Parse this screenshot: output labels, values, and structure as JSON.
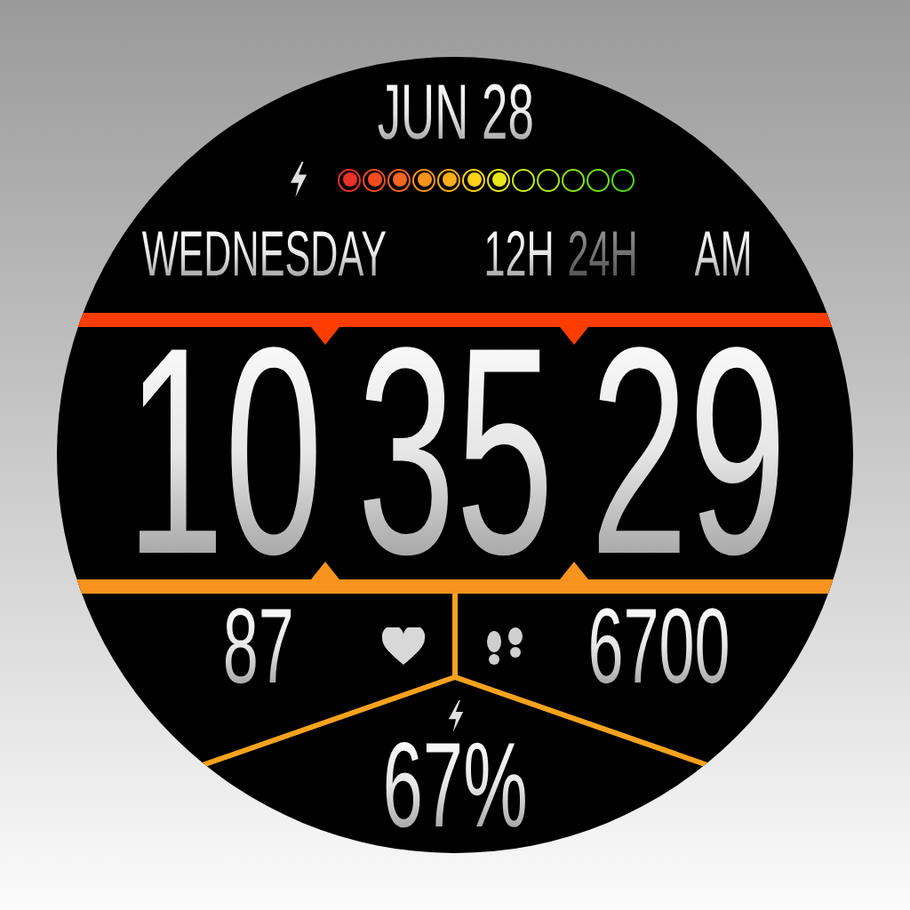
{
  "date": "JUN 28",
  "battery_dots": [
    {
      "color": "#e8322a",
      "filled": true
    },
    {
      "color": "#f04b23",
      "filled": true
    },
    {
      "color": "#f26522",
      "filled": true
    },
    {
      "color": "#f7941d",
      "filled": true
    },
    {
      "color": "#f9ad1a",
      "filled": true
    },
    {
      "color": "#fcd116",
      "filled": true
    },
    {
      "color": "#e8e51a",
      "filled": true
    },
    {
      "color": "#c8e81a",
      "filled": false
    },
    {
      "color": "#a6e51a",
      "filled": false
    },
    {
      "color": "#8ae01a",
      "filled": false
    },
    {
      "color": "#6cdc1a",
      "filled": false
    },
    {
      "color": "#4cd91a",
      "filled": false
    }
  ],
  "weekday": "WEDNESDAY",
  "time_format": [
    {
      "label": "12H",
      "selected": true
    },
    {
      "label": "24H",
      "selected": false
    }
  ],
  "ampm": "AM",
  "time": {
    "hours": "10",
    "minutes": "35",
    "seconds": "29"
  },
  "heart_rate": "87",
  "steps": "6700",
  "battery": "67%"
}
